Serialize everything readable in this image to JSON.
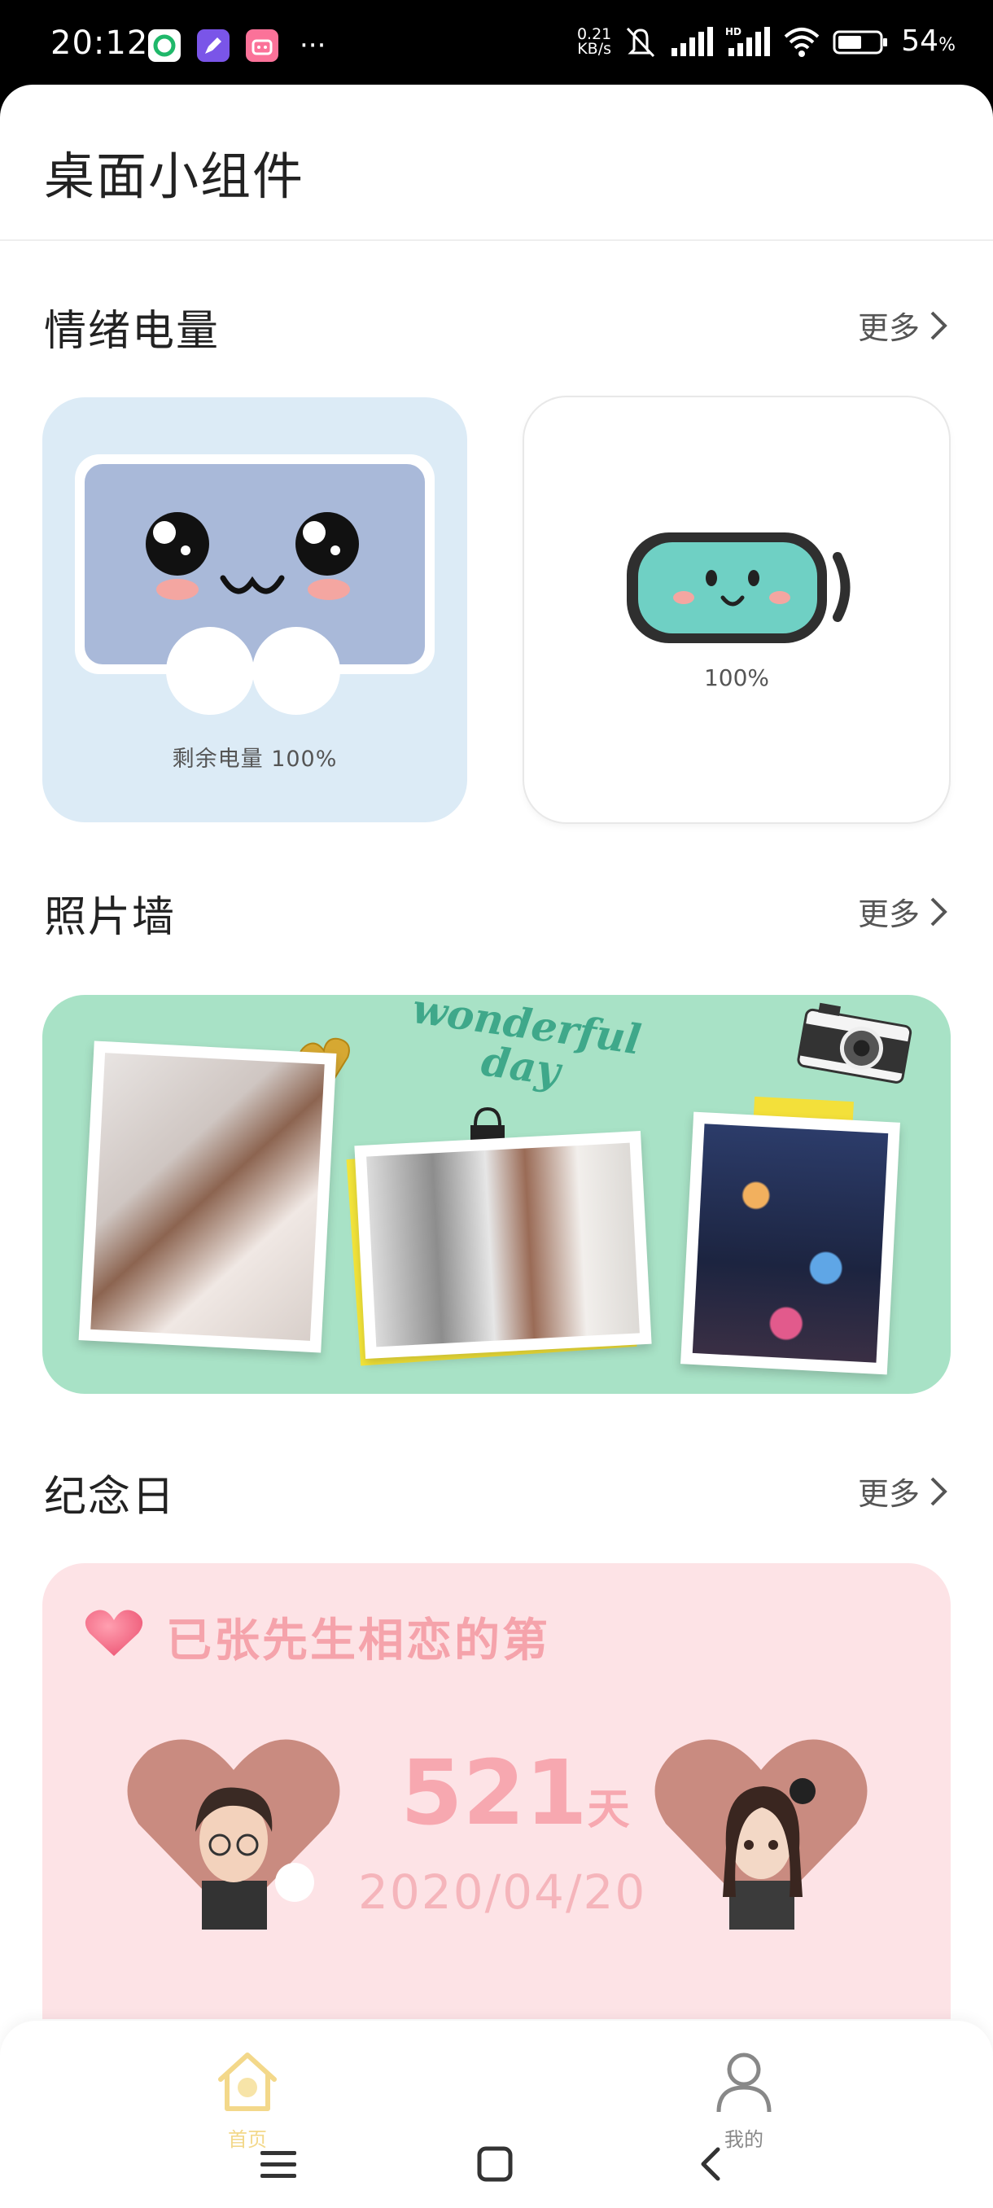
{
  "status_bar": {
    "time": "20:12",
    "net_speed_value": "0.21",
    "net_speed_unit": "KB/s",
    "battery_percent": "54",
    "battery_suffix": "%",
    "icons": [
      "wechat-like-app-icon",
      "rocket-app-icon",
      "bilibili-app-icon",
      "more-dots-icon",
      "mute-icon",
      "signal-icon",
      "hd-signal-icon",
      "wifi-icon",
      "battery-icon"
    ]
  },
  "page": {
    "title": "桌面小组件"
  },
  "sections": {
    "mood": {
      "title": "情绪电量",
      "more": "更多",
      "card1_label": "剩余电量   100%",
      "card2_label": "100%"
    },
    "photo_wall": {
      "title": "照片墙",
      "more": "更多",
      "deco_text_line1": "wonderful",
      "deco_text_line2": "day"
    },
    "anniversary": {
      "title": "纪念日",
      "more": "更多",
      "caption": "已张先生相恋的第",
      "days": "521",
      "days_unit": "天",
      "date": "2020/04/20"
    }
  },
  "bottom_nav": {
    "items": [
      {
        "label": "首页",
        "icon": "home-icon",
        "active": true
      },
      {
        "label": "我的",
        "icon": "person-icon",
        "active": false
      }
    ]
  },
  "colors": {
    "accent_yellow": "#f3d88a",
    "mood_card_bg": "#dcebf6",
    "photo_wall_bg": "#a8e2c6",
    "anniversary_bg": "#fde3e6"
  }
}
